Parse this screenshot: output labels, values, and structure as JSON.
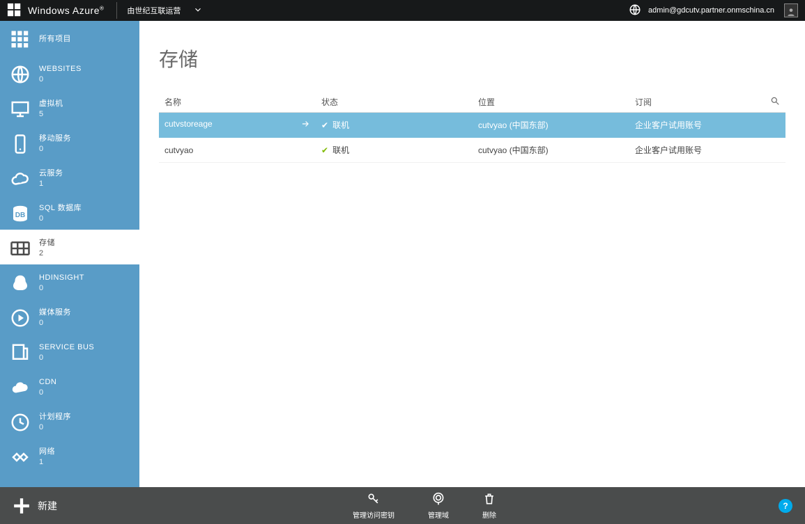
{
  "topbar": {
    "brand": "Windows Azure",
    "brand_mark": "®",
    "operator": "由世纪互联运营",
    "user_email": "admin@gdcutv.partner.onmschina.cn"
  },
  "sidebar": {
    "items": [
      {
        "label": "所有项目",
        "count": "",
        "icon": "grid-icon",
        "selected": false
      },
      {
        "label": "WEBSITES",
        "count": "0",
        "icon": "globe-icon",
        "selected": false
      },
      {
        "label": "虚拟机",
        "count": "5",
        "icon": "monitor-icon",
        "selected": false
      },
      {
        "label": "移动服务",
        "count": "0",
        "icon": "mobile-icon",
        "selected": false
      },
      {
        "label": "云服务",
        "count": "1",
        "icon": "cloud-icon",
        "selected": false
      },
      {
        "label": "SQL 数据库",
        "count": "0",
        "icon": "db-icon",
        "selected": false
      },
      {
        "label": "存储",
        "count": "2",
        "icon": "table-icon",
        "selected": true
      },
      {
        "label": "HDINSIGHT",
        "count": "0",
        "icon": "hdinsight-icon",
        "selected": false
      },
      {
        "label": "媒体服务",
        "count": "0",
        "icon": "media-icon",
        "selected": false
      },
      {
        "label": "SERVICE BUS",
        "count": "0",
        "icon": "servicebus-icon",
        "selected": false
      },
      {
        "label": "CDN",
        "count": "0",
        "icon": "cdn-icon",
        "selected": false
      },
      {
        "label": "计划程序",
        "count": "0",
        "icon": "scheduler-icon",
        "selected": false
      },
      {
        "label": "网络",
        "count": "1",
        "icon": "network-icon",
        "selected": false
      }
    ]
  },
  "main": {
    "title": "存储",
    "columns": {
      "name": "名称",
      "status": "状态",
      "location": "位置",
      "subscription": "订阅"
    },
    "rows": [
      {
        "name": "cutvstoreage",
        "status": "联机",
        "location": "cutvyao (中国东部)",
        "subscription": "企业客户试用账号",
        "selected": true
      },
      {
        "name": "cutvyao",
        "status": "联机",
        "location": "cutvyao (中国东部)",
        "subscription": "企业客户试用账号",
        "selected": false
      }
    ]
  },
  "cmdbar": {
    "new_label": "新建",
    "commands": [
      {
        "label": "管理访问密钥",
        "icon": "key-icon"
      },
      {
        "label": "管理域",
        "icon": "domain-icon"
      },
      {
        "label": "删除",
        "icon": "trash-icon"
      }
    ],
    "help": "?"
  }
}
